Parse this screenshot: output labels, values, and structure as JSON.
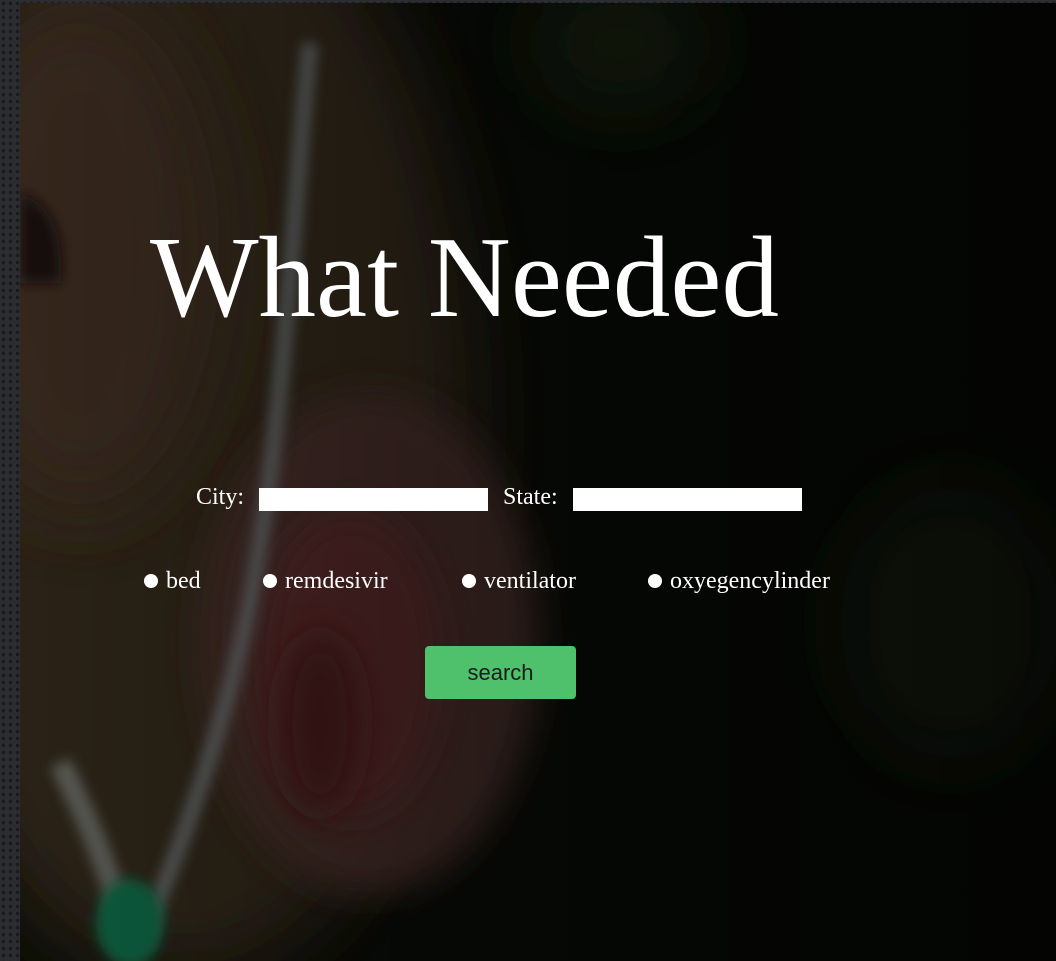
{
  "hero": {
    "title": "What Needed"
  },
  "form": {
    "city_label": "City:",
    "city_value": "",
    "state_label": "State:",
    "state_value": ""
  },
  "options": [
    {
      "label": "bed"
    },
    {
      "label": "remdesivir"
    },
    {
      "label": "ventilator"
    },
    {
      "label": "oxyegencylinder"
    }
  ],
  "actions": {
    "search_label": "search"
  },
  "colors": {
    "button_green": "#4fc06c",
    "text": "#ffffff",
    "overlay_dark": "#070a06"
  }
}
